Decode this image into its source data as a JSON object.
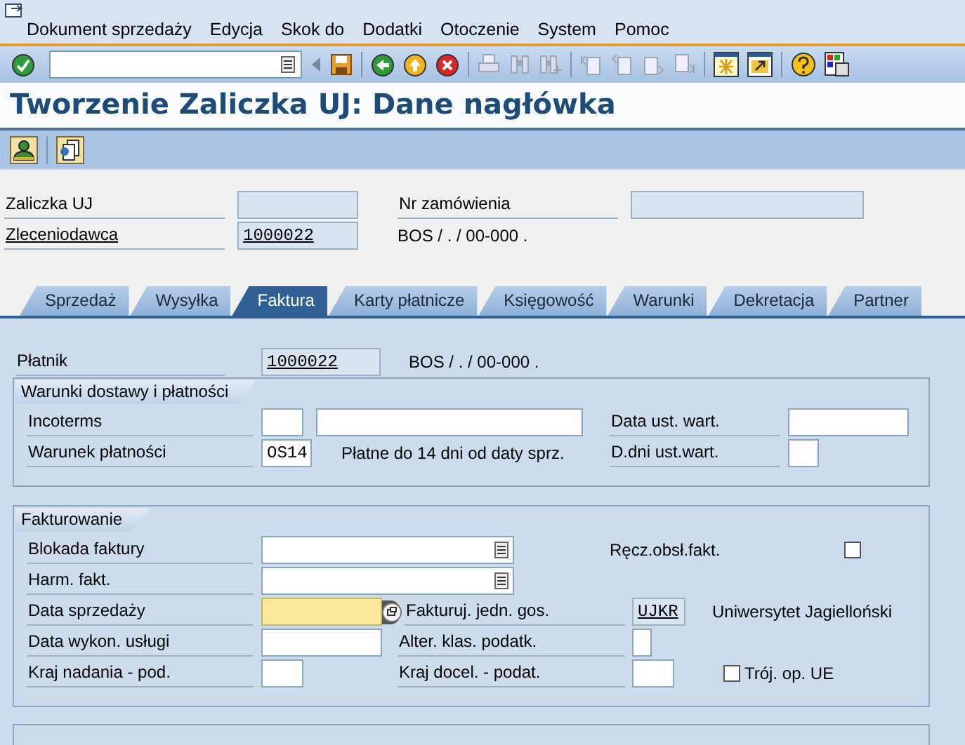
{
  "menu_bar": {
    "items": [
      "Dokument sprzedaży",
      "Edycja",
      "Skok do",
      "Dodatki",
      "Otoczenie",
      "System",
      "Pomoc"
    ]
  },
  "title": "Tworzenie Zaliczka UJ: Dane nagłówka",
  "header": {
    "rows": [
      {
        "cells": [
          {
            "kind": "label",
            "text": "Zaliczka UJ"
          },
          {
            "kind": "input",
            "editable": false
          },
          {
            "kind": "label",
            "text": "Nr zamówienia"
          },
          {
            "kind": "input",
            "editable": false
          }
        ]
      },
      {
        "cells": [
          {
            "kind": "link",
            "text": "Zleceniodawca"
          },
          {
            "kind": "input",
            "editable": false,
            "value": "1000022"
          },
          {
            "kind": "text",
            "text": "BOS / . / 00-000 ."
          }
        ]
      }
    ]
  },
  "tabs": [
    {
      "label": "Sprzedaż",
      "selected": false
    },
    {
      "label": "Wysyłka",
      "selected": false
    },
    {
      "label": "Faktura",
      "selected": true
    },
    {
      "label": "Karty płatnicze",
      "selected": false
    },
    {
      "label": "Księgowość",
      "selected": false
    },
    {
      "label": "Warunki",
      "selected": false
    },
    {
      "label": "Dekretacja",
      "selected": false
    },
    {
      "label": "Partner",
      "selected": false
    }
  ],
  "payer": {
    "cells": [
      {
        "kind": "label",
        "text": "Płatnik"
      },
      {
        "kind": "input",
        "editable": false,
        "value": "1000022"
      },
      {
        "kind": "text",
        "text": "BOS / . / 00-000 ."
      }
    ]
  },
  "groups": [
    {
      "title": "Warunki dostawy i płatności",
      "rows": [
        {
          "cells": [
            {
              "kind": "label",
              "text": "Incoterms"
            },
            {
              "kind": "input",
              "editable": true
            },
            {
              "kind": "input",
              "editable": true
            },
            {
              "kind": "label",
              "text": "Data ust. wart."
            },
            {
              "kind": "input",
              "editable": true
            }
          ]
        },
        {
          "cells": [
            {
              "kind": "label",
              "text": "Warunek płatności"
            },
            {
              "kind": "input",
              "editable": true,
              "value": "OS14"
            },
            {
              "kind": "text",
              "text": "Płatne do 14 dni od daty sprz."
            },
            {
              "kind": "label",
              "text": "D.dni ust.wart."
            },
            {
              "kind": "input",
              "editable": true
            }
          ]
        }
      ]
    },
    {
      "title": "Fakturowanie",
      "rows": [
        {
          "cells": [
            {
              "kind": "label",
              "text": "Blokada faktury"
            },
            {
              "kind": "input",
              "editable": true,
              "dropdown": true
            },
            "",
            {
              "kind": "text",
              "text": "Ręcz.obsł.fakt."
            },
            {
              "kind": "checkbox",
              "checked": false
            }
          ]
        },
        {
          "cells": [
            {
              "kind": "label",
              "text": "Harm. fakt."
            },
            {
              "kind": "input",
              "editable": true,
              "dropdown": true
            }
          ]
        },
        {
          "cells": [
            {
              "kind": "label",
              "text": "Data sprzedaży"
            },
            {
              "kind": "input",
              "editable": true,
              "focused": true
            },
            {
              "kind": "label",
              "text": "Fakturuj. jedn. gos."
            },
            {
              "kind": "input",
              "editable": false,
              "value": "UJKR"
            },
            {
              "kind": "text",
              "text": "Uniwersytet Jagielloński"
            }
          ]
        },
        {
          "cells": [
            {
              "kind": "label",
              "text": "Data wykon. usługi"
            },
            {
              "kind": "input",
              "editable": true
            },
            {
              "kind": "label",
              "text": "Alter. klas. podatk."
            },
            {
              "kind": "input",
              "editable": true
            }
          ]
        },
        {
          "cells": [
            {
              "kind": "label",
              "text": "Kraj nadania - pod."
            },
            {
              "kind": "input",
              "editable": true
            },
            {
              "kind": "label",
              "text": "Kraj docel. - podat."
            },
            {
              "kind": "input",
              "editable": true
            },
            {
              "kind": "checkbox",
              "checked": false,
              "label": "Trój. op. UE"
            }
          ]
        }
      ]
    }
  ]
}
